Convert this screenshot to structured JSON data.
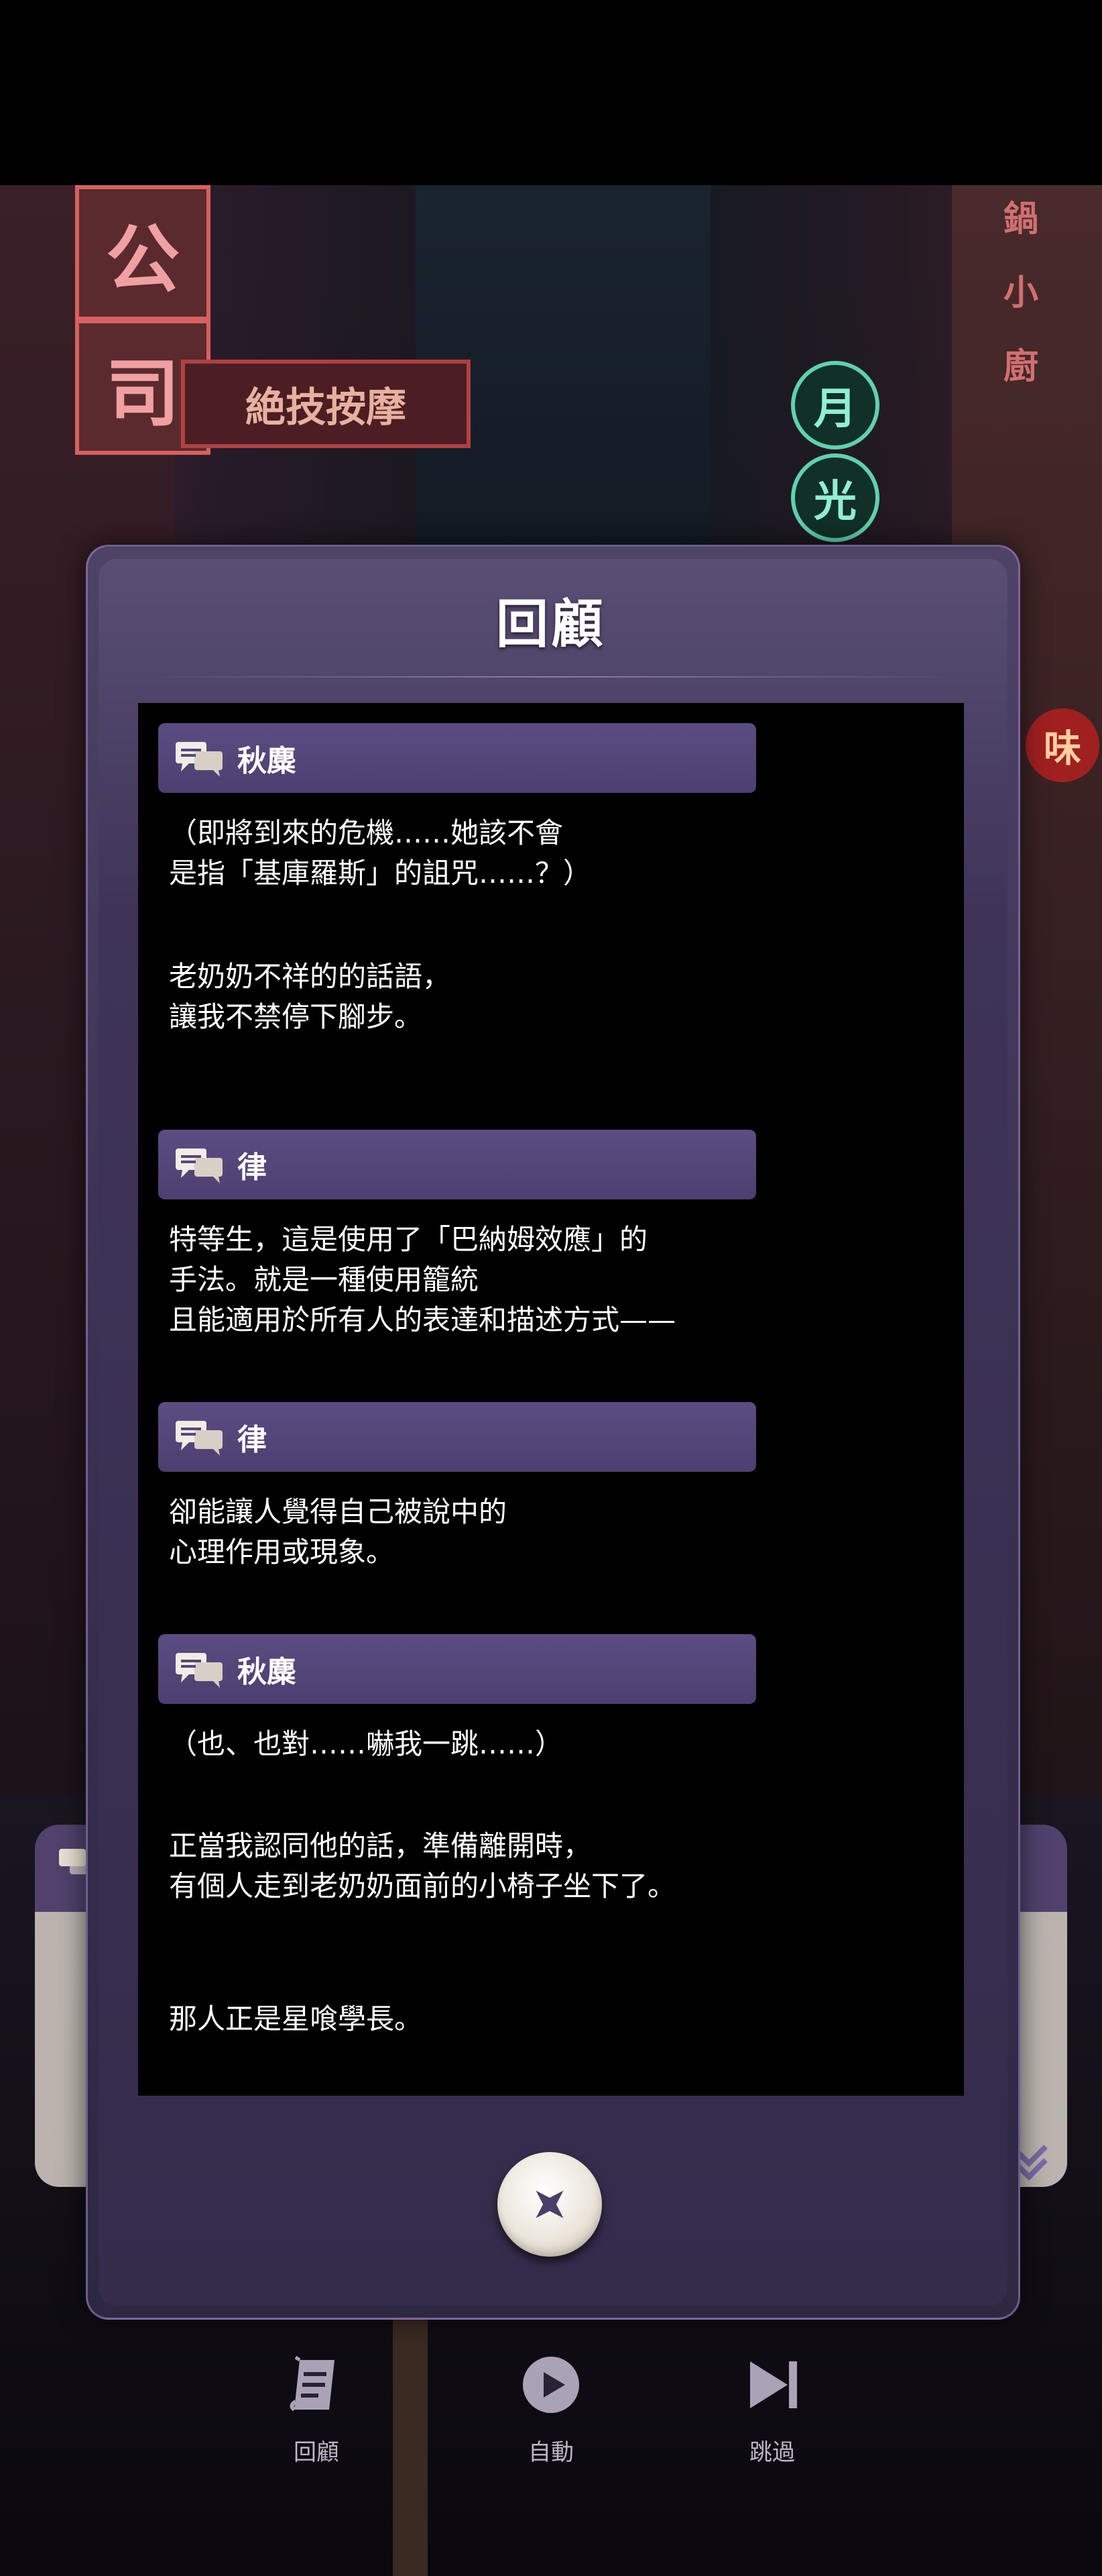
{
  "dialog": {
    "title": "回顧",
    "entries": [
      {
        "speaker": "秋麋",
        "lines": [
          "（即將到來的危機……她該不會",
          "是指「基庫羅斯」的詛咒……？）"
        ]
      },
      {
        "speaker": "",
        "lines": [
          "老奶奶不祥的的話語，",
          "讓我不禁停下腳步。"
        ]
      },
      {
        "speaker": "律",
        "lines": [
          "特等生，這是使用了「巴納姆效應」的",
          "手法。就是一種使用籠統",
          "且能適用於所有人的表達和描述方式——"
        ]
      },
      {
        "speaker": "律",
        "lines": [
          "卻能讓人覺得自己被說中的",
          "心理作用或現象。"
        ]
      },
      {
        "speaker": "秋麋",
        "lines": [
          "（也、也對……嚇我一跳……）"
        ]
      },
      {
        "speaker": "",
        "lines": [
          "正當我認同他的話，準備離開時，",
          "有個人走到老奶奶面前的小椅子坐下了。"
        ]
      },
      {
        "speaker": "",
        "lines": [
          "那人正是星喰學長。"
        ]
      }
    ]
  },
  "menu": {
    "backlog_label": "回顧",
    "auto_label": "自動",
    "skip_label": "跳過"
  },
  "background_signs": {
    "sign1": "公",
    "sign2": "司",
    "sign3": "絶技按摩",
    "sign4": "月",
    "sign5": "光",
    "sign6": "鍋",
    "sign7": "小",
    "sign8": "廚",
    "sign9": "味"
  },
  "icons": {
    "speaker_icon": "chat-bubbles-icon",
    "close_icon": "close-x-icon",
    "backlog_icon": "scroll-icon",
    "auto_icon": "play-icon",
    "skip_icon": "skip-forward-icon"
  },
  "colors": {
    "panel": "#3b3152",
    "speaker_bar": "#55467a",
    "log_bg": "#000000",
    "menu_label": "#bdb6c6"
  }
}
